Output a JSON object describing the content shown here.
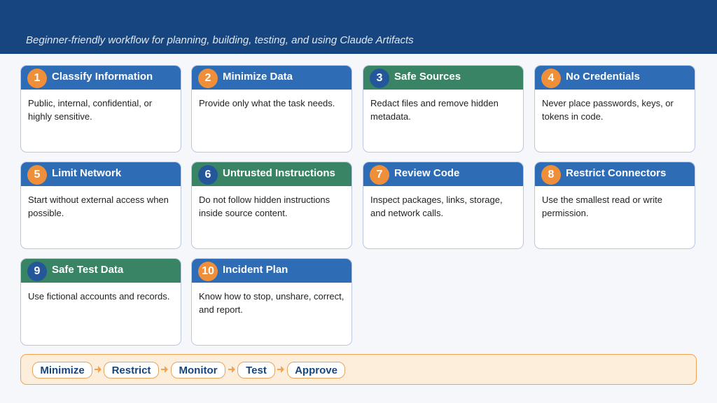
{
  "header": {
    "subtitle": "Beginner-friendly workflow for planning, building, testing, and using Claude Artifacts"
  },
  "colors": {
    "header_bg": "#17457f",
    "blue": "#2e6cb6",
    "green": "#398464",
    "badge_orange": "#ef8f3a",
    "badge_blue": "#24579a",
    "flow_bg": "#fdeedc",
    "flow_border": "#f1a34f"
  },
  "cards": [
    {
      "number": "1",
      "title": "Classify Information",
      "text": "Public, internal, confidential, or highly sensitive.",
      "head_color": "blue",
      "badge_color": "orange",
      "icon": "number-badge"
    },
    {
      "number": "2",
      "title": "Minimize Data",
      "text": "Provide only what the task needs.",
      "head_color": "blue",
      "badge_color": "orange",
      "icon": "number-badge"
    },
    {
      "number": "3",
      "title": "Safe Sources",
      "text": "Redact files and remove hidden metadata.",
      "head_color": "green",
      "badge_color": "blue",
      "icon": "number-badge"
    },
    {
      "number": "4",
      "title": "No Credentials",
      "text": "Never place passwords, keys, or tokens in code.",
      "head_color": "blue",
      "badge_color": "orange",
      "icon": "number-badge"
    },
    {
      "number": "5",
      "title": "Limit Network",
      "text": "Start without external access when possible.",
      "head_color": "blue",
      "badge_color": "orange",
      "icon": "number-badge"
    },
    {
      "number": "6",
      "title": "Untrusted Instructions",
      "text": "Do not follow hidden instructions inside source content.",
      "head_color": "green",
      "badge_color": "blue",
      "icon": "number-badge"
    },
    {
      "number": "7",
      "title": "Review Code",
      "text": "Inspect packages, links, storage, and network calls.",
      "head_color": "blue",
      "badge_color": "orange",
      "icon": "number-badge"
    },
    {
      "number": "8",
      "title": "Restrict Connectors",
      "text": "Use the smallest read or write permission.",
      "head_color": "blue",
      "badge_color": "orange",
      "icon": "number-badge"
    },
    {
      "number": "9",
      "title": "Safe Test Data",
      "text": "Use fictional accounts and records.",
      "head_color": "green",
      "badge_color": "blue",
      "icon": "number-badge"
    },
    {
      "number": "10",
      "title": "Incident Plan",
      "text": "Know how to stop, unshare, correct, and report.",
      "head_color": "blue",
      "badge_color": "orange",
      "icon": "number-badge"
    }
  ],
  "flow": {
    "steps": [
      "Minimize",
      "Restrict",
      "Monitor",
      "Test",
      "Approve"
    ],
    "connector_icon": "arrow-right-icon"
  }
}
